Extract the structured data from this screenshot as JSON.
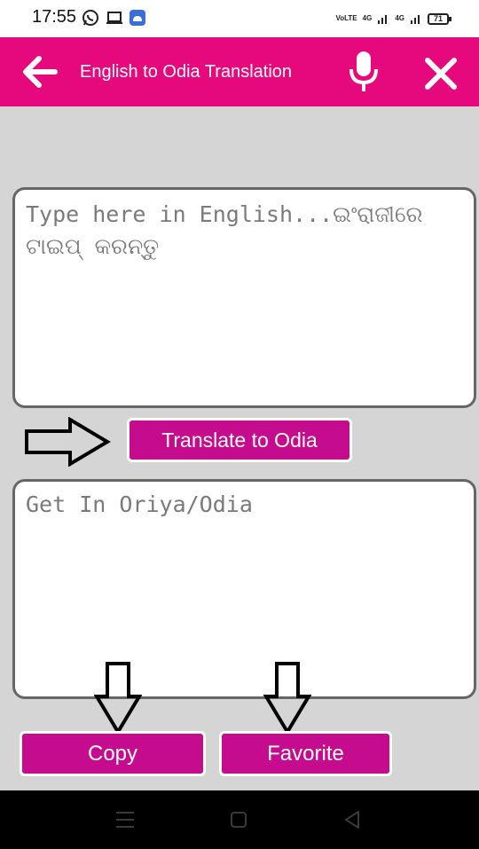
{
  "status_bar": {
    "time": "17:55",
    "left_icons": [
      "whatsapp-icon",
      "laptop-icon",
      "android-icon"
    ],
    "network_1": "VoLTE",
    "network_2": "4G",
    "network_3": "4G",
    "battery": "71"
  },
  "app_bar": {
    "title": "English to Odia Translation",
    "background_color": "#e6097d",
    "icons": [
      "arrow-left-icon",
      "microphone-icon",
      "close-icon"
    ]
  },
  "input": {
    "value": "",
    "placeholder": "Type here in English...ଇଂରାଜୀରେ ଟାଇପ୍ କରନ୍ତୁ"
  },
  "translate_button": {
    "label": "Translate to Odia",
    "color": "#c60c8e"
  },
  "output": {
    "value": "",
    "placeholder": "Get In Oriya/Odia"
  },
  "actions": {
    "copy_label": "Copy",
    "favorite_label": "Favorite"
  },
  "nav_bar": {
    "icons": [
      "menu-icon",
      "home-icon",
      "back-icon"
    ]
  }
}
